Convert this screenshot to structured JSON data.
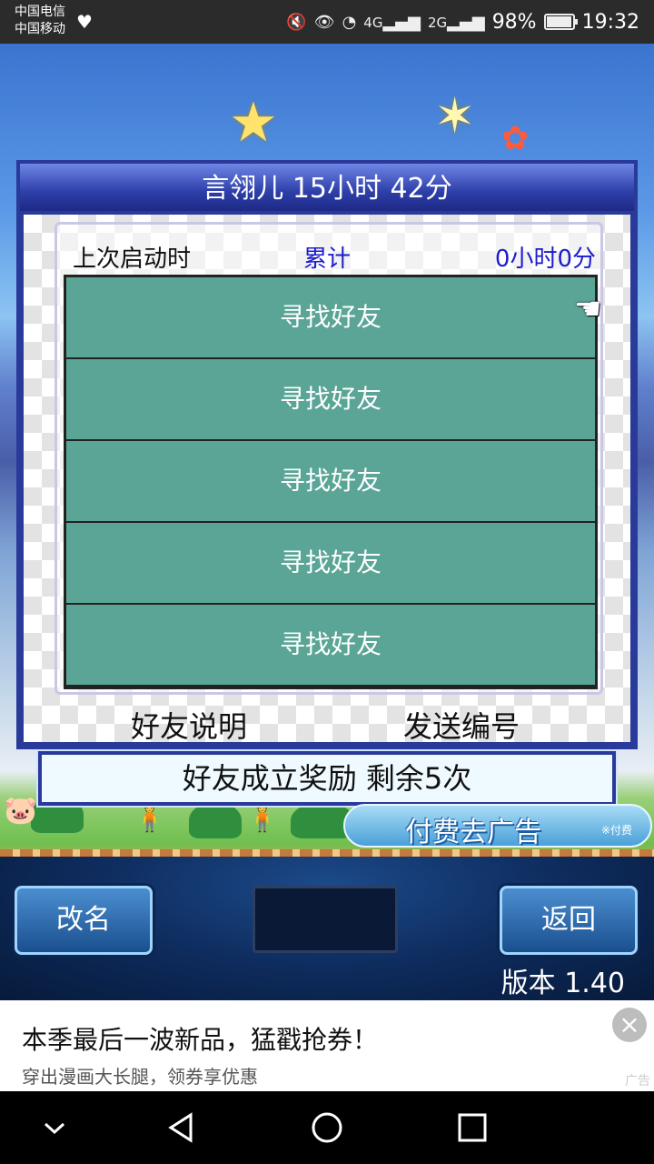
{
  "status_bar": {
    "carrier1": "中国电信",
    "carrier2": "中国移动",
    "net_4g": "4G",
    "net_2g": "2G",
    "battery_text": "98%",
    "battery_level": 0.98,
    "time": "19:32"
  },
  "dialog": {
    "title": "言翎儿  15小时 42分",
    "last_launch_label": "上次启动时",
    "cumulative_label": "累计",
    "cumulative_value": "0小时0分",
    "slots": [
      "寻找好友",
      "寻找好友",
      "寻找好友",
      "寻找好友",
      "寻找好友"
    ],
    "friend_help": "好友说明",
    "send_code": "发送编号"
  },
  "reward_banner": "好友成立奖励  剩余5次",
  "remove_ads": {
    "label": "付费去广告",
    "note": "※付费"
  },
  "controls": {
    "rename": "改名",
    "back": "返回",
    "version": "版本 1.40"
  },
  "ad": {
    "title": "本季最后一波新品，猛戳抢券！",
    "subtitle": "穿出漫画大长腿，领券享优惠",
    "tag": "广告"
  },
  "colors": {
    "dialog_border": "#2a3a9a",
    "slot_green": "#5aa596",
    "accent_blue_text": "#1c1ccc"
  }
}
